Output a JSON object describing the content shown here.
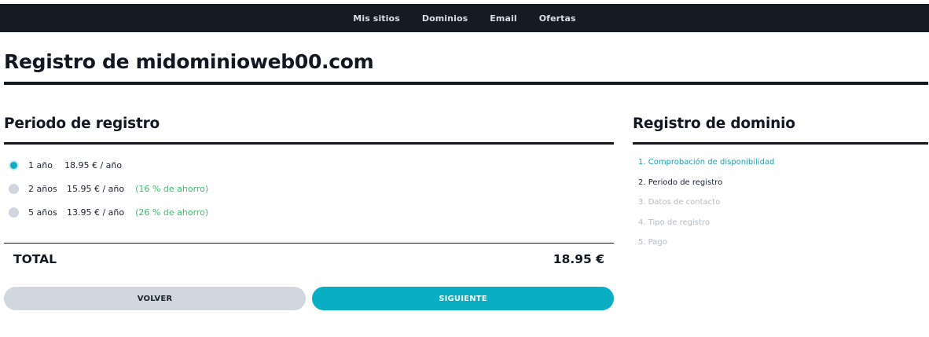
{
  "nav": {
    "items": [
      {
        "label": "Mis sitios"
      },
      {
        "label": "Dominios"
      },
      {
        "label": "Email"
      },
      {
        "label": "Ofertas"
      }
    ]
  },
  "page": {
    "title": "Registro de midominioweb00.com"
  },
  "period": {
    "heading": "Periodo de registro",
    "options": [
      {
        "term": "1 año",
        "price": "18.95 € / año",
        "saving": "",
        "selected": true
      },
      {
        "term": "2 años",
        "price": "15.95 € / año",
        "saving": "(16 % de ahorro)",
        "selected": false
      },
      {
        "term": "5 años",
        "price": "13.95 € / año",
        "saving": "(26 % de ahorro)",
        "selected": false
      }
    ]
  },
  "total": {
    "label": "TOTAL",
    "value": "18.95 €"
  },
  "buttons": {
    "back_label": "VOLVER",
    "next_label": "SIGUIENTE"
  },
  "sidebar": {
    "heading": "Registro de dominio",
    "steps": [
      {
        "label": "1. Comprobación de disponibilidad",
        "state": "done"
      },
      {
        "label": "2. Periodo de registro",
        "state": "current"
      },
      {
        "label": "3. Datos de contacto",
        "state": "pending"
      },
      {
        "label": "4. Tipo de registro",
        "state": "pending"
      },
      {
        "label": "5. Pago",
        "state": "pending"
      }
    ]
  },
  "colors": {
    "accent": "#0aaec3",
    "saving": "#3cbf6c",
    "navbar": "#151b24"
  }
}
